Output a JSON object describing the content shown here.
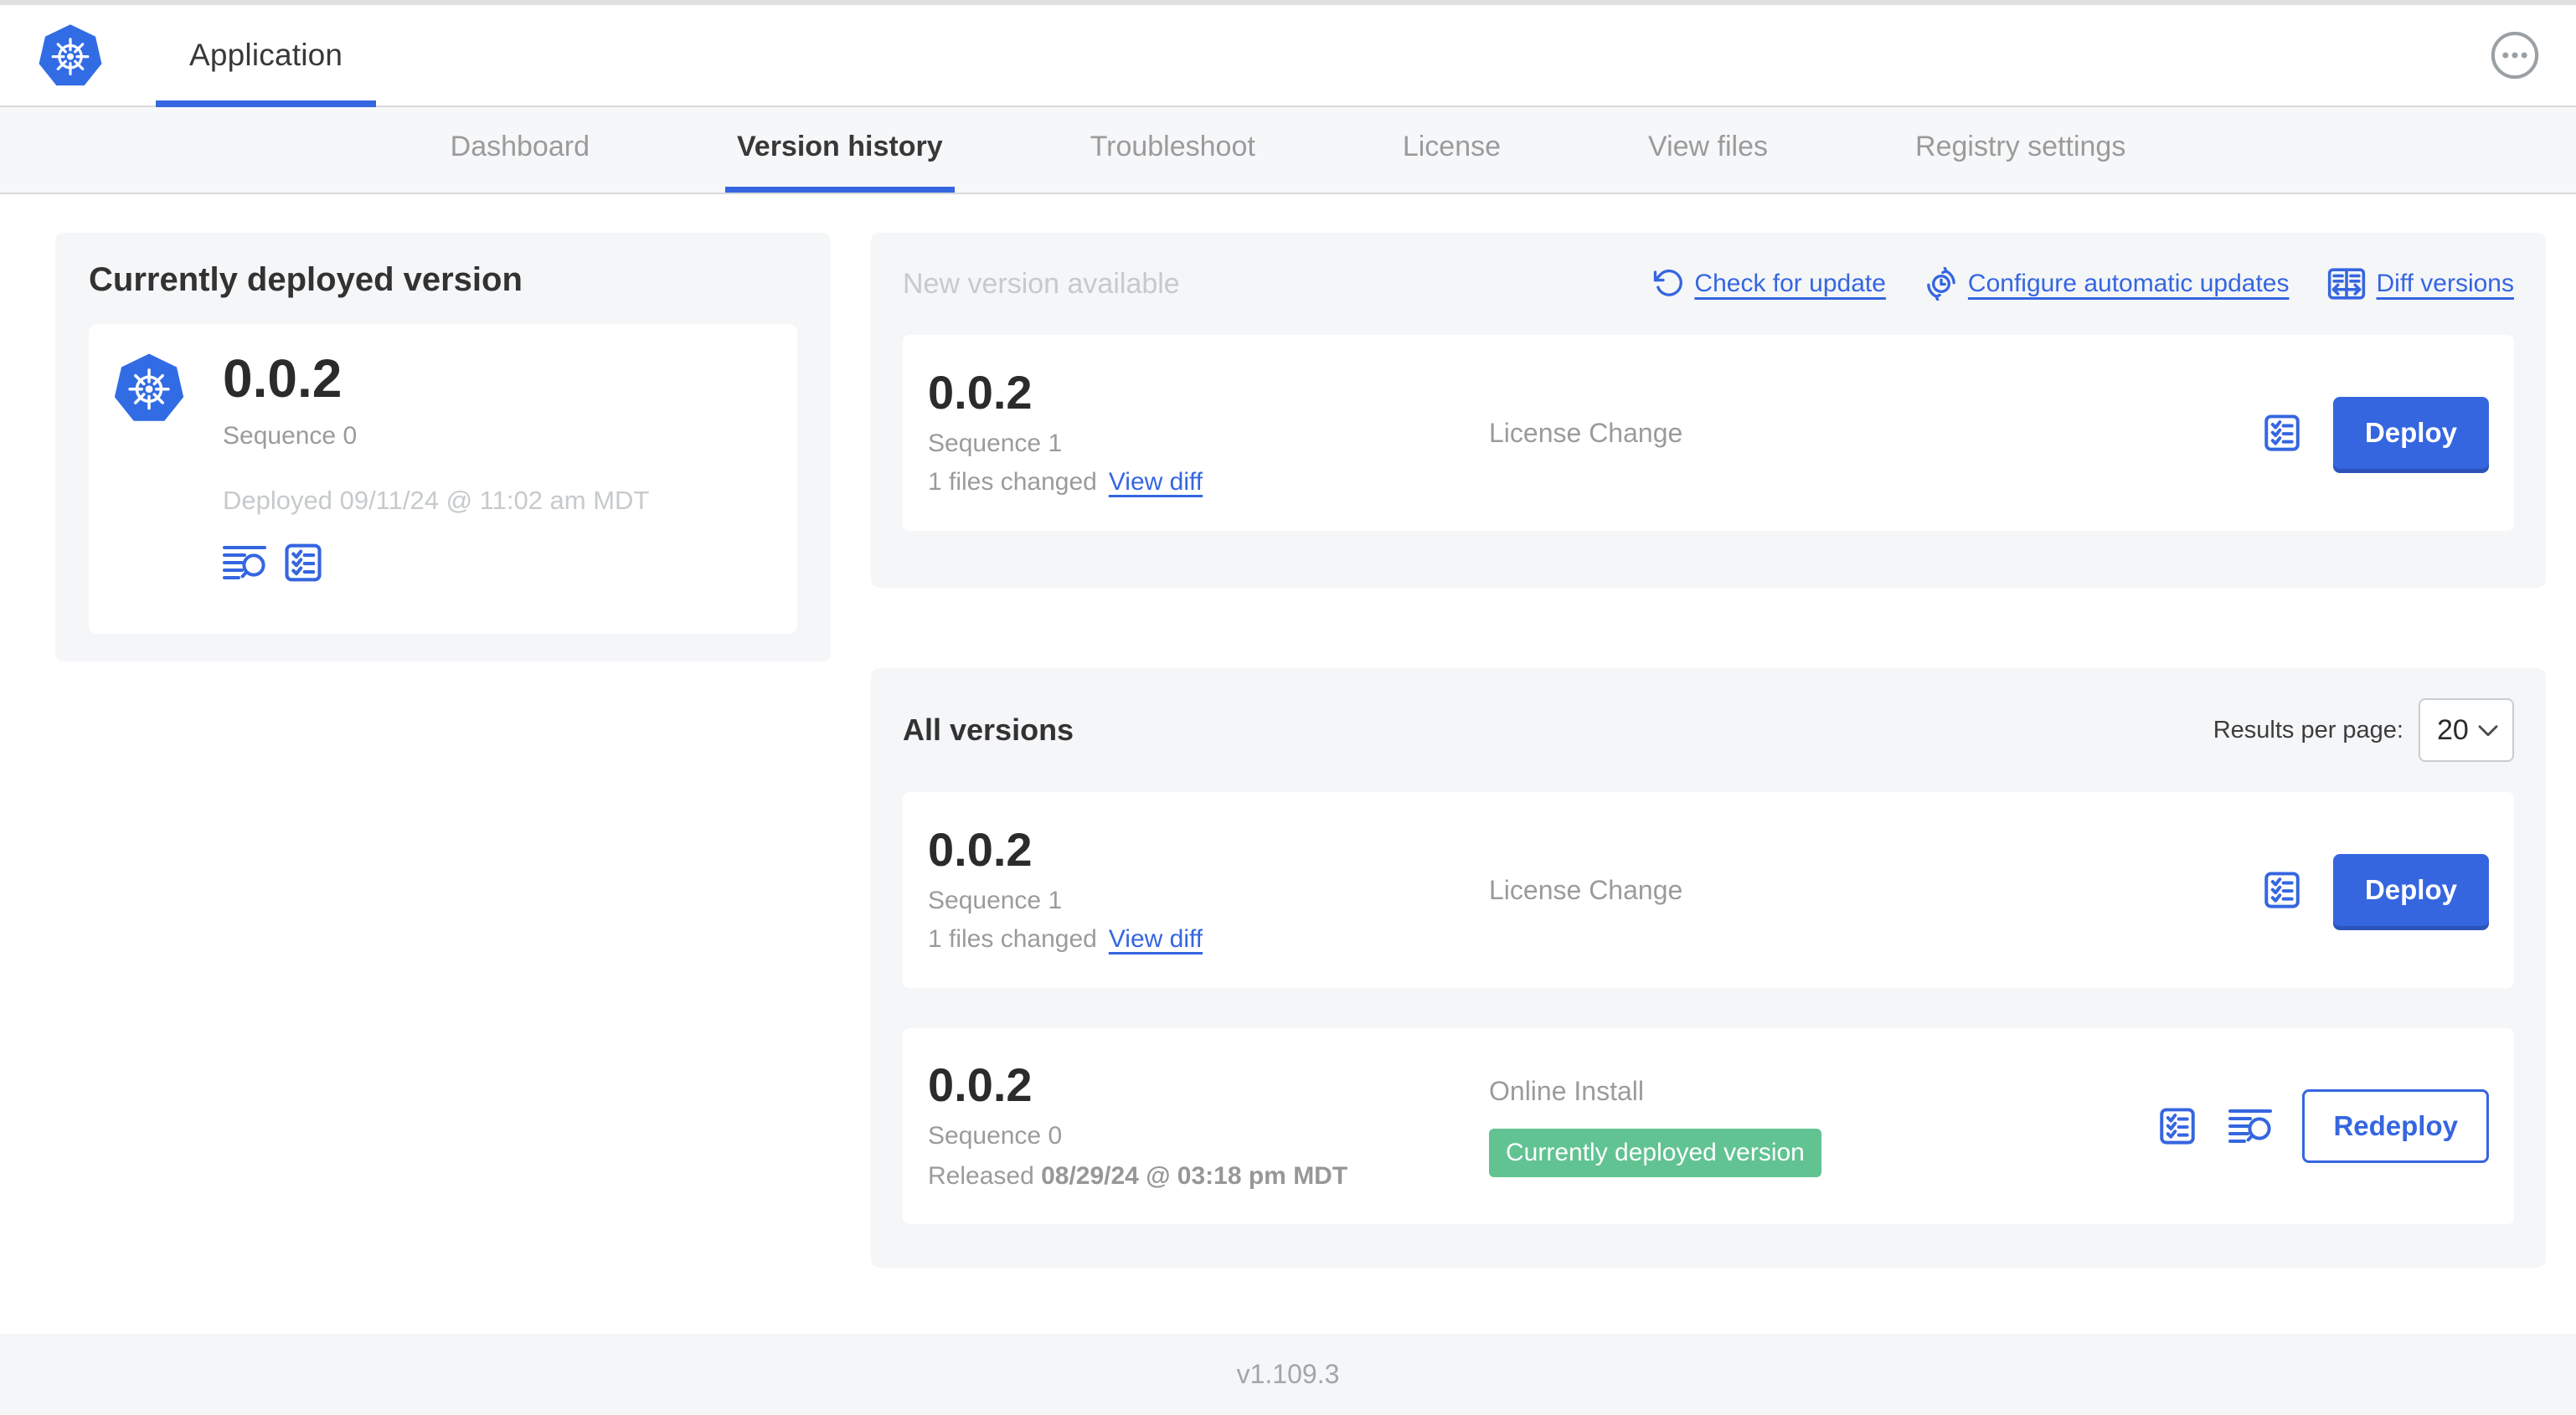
{
  "app": {
    "title": "Application"
  },
  "header": {
    "menu_icon": "ellipsis-in-circle"
  },
  "tabs": [
    {
      "label": "Dashboard",
      "active": false
    },
    {
      "label": "Version history",
      "active": true
    },
    {
      "label": "Troubleshoot",
      "active": false
    },
    {
      "label": "License",
      "active": false
    },
    {
      "label": "View files",
      "active": false
    },
    {
      "label": "Registry settings",
      "active": false
    }
  ],
  "current": {
    "title": "Currently deployed version",
    "version": "0.0.2",
    "sequence": "Sequence 0",
    "deployed": "Deployed 09/11/24 @ 11:02 am MDT",
    "icons": [
      "logs-icon",
      "checklist-icon"
    ]
  },
  "newver": {
    "title": "New version available",
    "actions": [
      {
        "label": "Check for update",
        "icon": "refresh-icon"
      },
      {
        "label": "Configure automatic updates",
        "icon": "auto-update-clock-icon"
      },
      {
        "label": "Diff versions",
        "icon": "diff-icon"
      }
    ],
    "row": {
      "version": "0.0.2",
      "sequence": "Sequence 1",
      "files_changed": "1 files changed",
      "view_diff": "View diff",
      "source": "License Change",
      "deploy_label": "Deploy"
    }
  },
  "allver": {
    "title": "All versions",
    "rpp_label": "Results per page:",
    "rpp_value": "20",
    "rows": [
      {
        "version": "0.0.2",
        "sequence": "Sequence 1",
        "files_changed": "1 files changed",
        "view_diff": "View diff",
        "source": "License Change",
        "deploy_label": "Deploy"
      },
      {
        "version": "0.0.2",
        "sequence": "Sequence 0",
        "released_prefix": "Released ",
        "released_date": "08/29/24 @ 03:18 pm MDT",
        "source": "Online Install",
        "badge": "Currently deployed version",
        "redeploy_label": "Redeploy"
      }
    ]
  },
  "footer": {
    "version": "v1.109.3"
  },
  "colors": {
    "primary_blue": "#3566e0",
    "k8s_logo_blue": "#326ce5",
    "badge_green": "#61c392",
    "panel_gray": "#f5f6f8",
    "muted_text": "#9b9b9b",
    "faint_text": "#c6cacc",
    "dark_text": "#323232"
  }
}
